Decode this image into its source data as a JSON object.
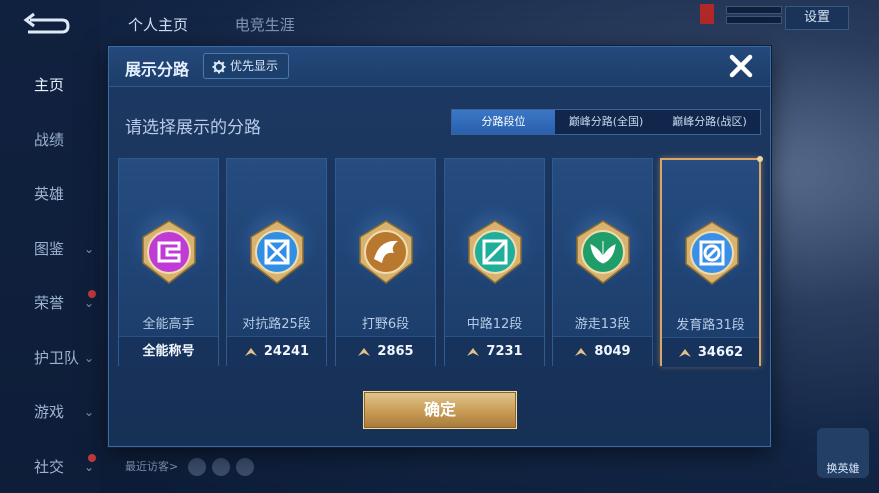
{
  "background": {
    "top_tabs": [
      "个人主页",
      "电竞生涯"
    ],
    "settings_label": "设置",
    "side_nav": [
      {
        "label": "主页",
        "active": true,
        "chevron": false
      },
      {
        "label": "战绩",
        "active": false,
        "chevron": false
      },
      {
        "label": "英雄",
        "active": false,
        "chevron": false
      },
      {
        "label": "图鉴",
        "active": false,
        "chevron": true
      },
      {
        "label": "荣誉",
        "active": false,
        "chevron": true
      },
      {
        "label": "护卫队",
        "active": false,
        "chevron": true
      },
      {
        "label": "游戏",
        "active": false,
        "chevron": true
      },
      {
        "label": "社交",
        "active": false,
        "chevron": true
      }
    ],
    "recent_visitors_label": "最近访客>",
    "right_buttons": [
      "换英雄"
    ]
  },
  "modal": {
    "title": "展示分路",
    "priority_label": "优先显示",
    "subtitle": "请选择展示的分路",
    "tabs": [
      {
        "label": "分路段位",
        "active": true
      },
      {
        "label": "巅峰分路(全国)",
        "active": false
      },
      {
        "label": "巅峰分路(战区)",
        "active": false
      }
    ],
    "cards": [
      {
        "name": "全能高手",
        "foot": "全能称号",
        "has_points_icon": false,
        "emblem": "allround-emblem-icon",
        "color": "#c03ad6",
        "selected": false
      },
      {
        "name": "对抗路25段",
        "foot": "24241",
        "has_points_icon": true,
        "emblem": "clash-lane-emblem-icon",
        "color": "#2f8ee6",
        "selected": false
      },
      {
        "name": "打野6段",
        "foot": "2865",
        "has_points_icon": true,
        "emblem": "jungle-emblem-icon",
        "color": "#b8782e",
        "selected": false
      },
      {
        "name": "中路12段",
        "foot": "7231",
        "has_points_icon": true,
        "emblem": "mid-lane-emblem-icon",
        "color": "#1fae9b",
        "selected": false
      },
      {
        "name": "游走13段",
        "foot": "8049",
        "has_points_icon": true,
        "emblem": "roam-emblem-icon",
        "color": "#1f9e6a",
        "selected": false
      },
      {
        "name": "发育路31段",
        "foot": "34662",
        "has_points_icon": true,
        "emblem": "farm-lane-emblem-icon",
        "color": "#3a8fe8",
        "selected": true
      }
    ],
    "confirm_label": "确定",
    "accent_gold": "#d9a66a"
  }
}
